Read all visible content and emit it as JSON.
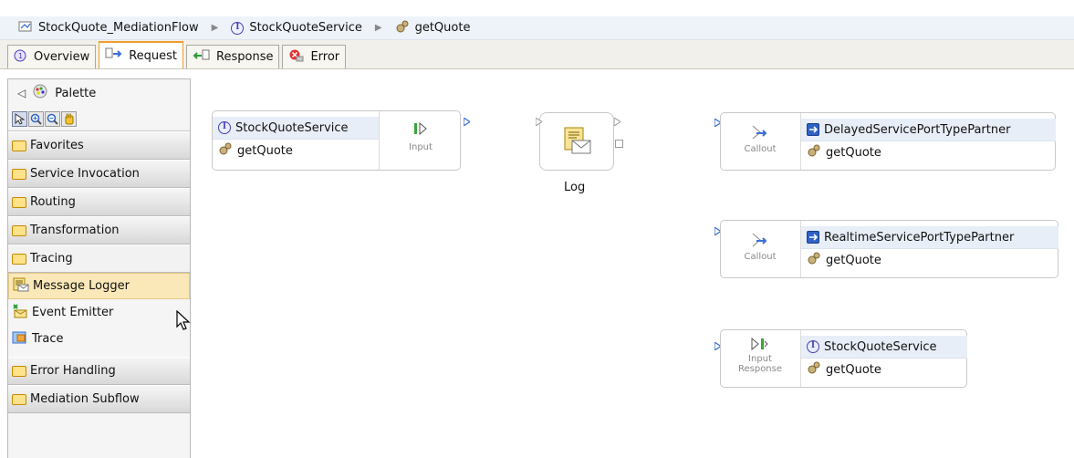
{
  "breadcrumb": {
    "flow": "StockQuote_MediationFlow",
    "interface": "StockQuoteService",
    "operation": "getQuote"
  },
  "tabs": [
    {
      "label": "Overview",
      "icon": "overview-icon",
      "active": false
    },
    {
      "label": "Request",
      "icon": "request-icon",
      "active": true
    },
    {
      "label": "Response",
      "icon": "response-icon",
      "active": false
    },
    {
      "label": "Error",
      "icon": "error-icon",
      "active": false
    }
  ],
  "palette": {
    "title": "Palette",
    "drawers": {
      "favorites": "Favorites",
      "service_invocation": "Service Invocation",
      "routing": "Routing",
      "transformation": "Transformation",
      "tracing": "Tracing",
      "error_handling": "Error Handling",
      "mediation_subflow": "Mediation Subflow"
    },
    "tracing_items": {
      "message_logger": "Message Logger",
      "event_emitter": "Event Emitter",
      "trace": "Trace"
    }
  },
  "canvas": {
    "input_node": {
      "interface": "StockQuoteService",
      "operation": "getQuote",
      "terminal": "Input"
    },
    "log_node": {
      "label": "Log"
    },
    "callout1": {
      "terminal": "Callout",
      "partner": "DelayedServicePortTypePartner",
      "operation": "getQuote"
    },
    "callout2": {
      "terminal": "Callout",
      "partner": "RealtimeServicePortTypePartner",
      "operation": "getQuote"
    },
    "input_response": {
      "terminal_line1": "Input",
      "terminal_line2": "Response",
      "interface": "StockQuoteService",
      "operation": "getQuote"
    }
  },
  "colors": {
    "active_tab_border": "#f09d2f",
    "header_fill": "#e8eef8",
    "port": "#3b6fd8"
  }
}
